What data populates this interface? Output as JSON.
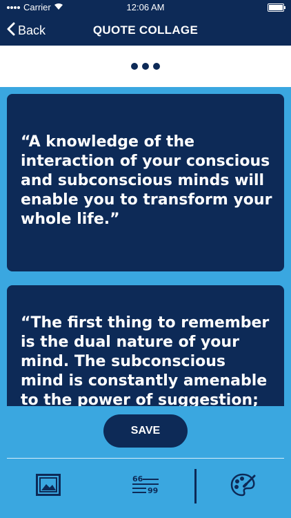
{
  "status_bar": {
    "carrier": "Carrier",
    "time": "12:06 AM"
  },
  "nav": {
    "back_label": "Back",
    "title": "QUOTE COLLAGE"
  },
  "quotes": [
    "“A knowledge of the interaction of your conscious and subconscious minds will enable you to transform your whole life.”",
    "“The first thing to remember is the dual nature of your mind. The subconscious mind is constantly amenable to the power of suggestion;"
  ],
  "actions": {
    "save_label": "SAVE"
  },
  "toolbar": {
    "image_icon": "image-icon",
    "quote_icon": "quote-text-icon",
    "palette_icon": "palette-icon"
  },
  "colors": {
    "navy": "#0d2a57",
    "sky": "#3aa7e0",
    "white": "#ffffff"
  }
}
